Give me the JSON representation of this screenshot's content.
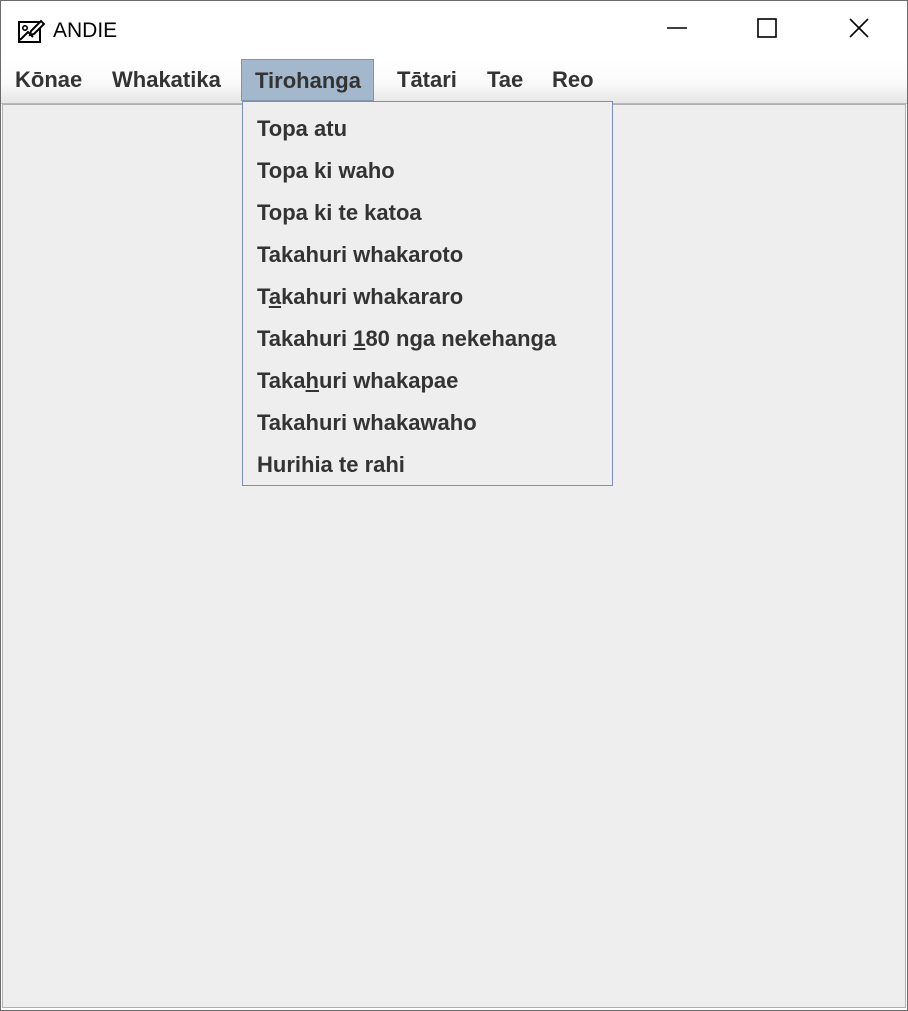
{
  "window": {
    "title": "ANDIE",
    "icon": "image-edit-icon",
    "controls": [
      "minimize-icon",
      "maximize-icon",
      "close-icon"
    ]
  },
  "menubar": {
    "items": [
      {
        "label": "Kōnae"
      },
      {
        "label": "Whakatika"
      },
      {
        "label": "Tirohanga",
        "active": true
      },
      {
        "label": "Tātari"
      },
      {
        "label": "Tae"
      },
      {
        "label": "Reo"
      }
    ]
  },
  "dropdown": {
    "items": [
      {
        "label": "Topa atu"
      },
      {
        "label": "Topa ki waho"
      },
      {
        "label": "Topa ki te katoa"
      },
      {
        "label": "Takahuri whakaroto"
      },
      {
        "label_pre": "T",
        "label_mnemonic": "a",
        "label_post": "kahuri whakararo"
      },
      {
        "label_pre": "Takahuri ",
        "label_mnemonic": "1",
        "label_post": "80 nga nekehanga"
      },
      {
        "label_pre": "Taka",
        "label_mnemonic": "h",
        "label_post": "uri whakapae"
      },
      {
        "label": "Takahuri whakawaho"
      },
      {
        "label": "Hurihia te rahi"
      }
    ]
  },
  "colors": {
    "menu_active_bg": "#a3b8cc",
    "dropdown_bg": "#eeeeee",
    "dropdown_border": "#7a8ec4",
    "text": "#333333"
  }
}
